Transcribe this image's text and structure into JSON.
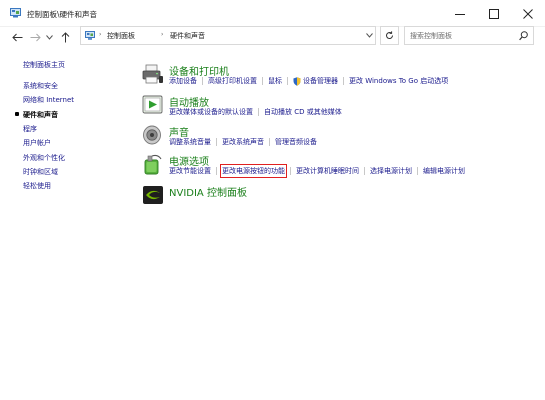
{
  "window": {
    "title": "控制面板\\硬件和声音"
  },
  "address": {
    "crumbs": [
      "控制面板",
      "硬件和声音"
    ]
  },
  "search": {
    "placeholder": "搜索控制面板"
  },
  "sidebar": {
    "items": [
      {
        "label": "控制面板主页",
        "current": false
      },
      {
        "label": "系统和安全",
        "current": false
      },
      {
        "label": "网络和 Internet",
        "current": false
      },
      {
        "label": "硬件和声音",
        "current": true
      },
      {
        "label": "程序",
        "current": false
      },
      {
        "label": "用户帐户",
        "current": false
      },
      {
        "label": "外观和个性化",
        "current": false
      },
      {
        "label": "时钟和区域",
        "current": false
      },
      {
        "label": "轻松使用",
        "current": false
      }
    ]
  },
  "categories": {
    "devices": {
      "title": "设备和打印机",
      "links": [
        "添加设备",
        "高级打印机设置",
        "鼠标",
        "设备管理器",
        "更改 Windows To Go 启动选项"
      ]
    },
    "autoplay": {
      "title": "自动播放",
      "links": [
        "更改媒体或设备的默认设置",
        "自动播放 CD 或其他媒体"
      ]
    },
    "sound": {
      "title": "声音",
      "links": [
        "调整系统音量",
        "更改系统声音",
        "管理音频设备"
      ]
    },
    "power": {
      "title": "电源选项",
      "links": [
        "更改节能设置",
        "更改电源按钮的功能",
        "更改计算机睡眠时间",
        "选择电源计划",
        "编辑电源计划"
      ]
    },
    "nvidia": {
      "title": "NVIDIA 控制面板"
    }
  },
  "colors": {
    "link": "#1a1a8c",
    "category_title": "#1a7f1a",
    "highlight_box": "#e02020"
  }
}
